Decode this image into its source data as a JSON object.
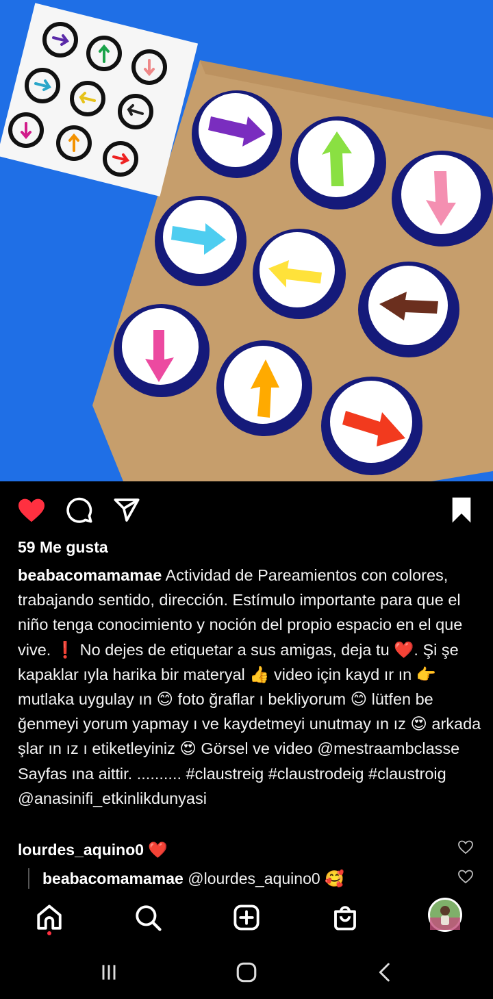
{
  "post": {
    "likes": "59 Me gusta",
    "author": "beabacomamamae",
    "caption": " Actividad de Pareamientos con colores, trabajando sentido, dirección. Estímulo importante para que el niño tenga conocimiento y noción del propio espacio en el que vive. ❗ No dejes de etiquetar a sus amigas, deja tu ❤️. Şi şe kapaklar ıyla harika bir materyal 👍 video için kayd ır ın 👉 mutlaka uygulay ın 😊 foto ğraflar ı bekliyorum 😊 lütfen be ğenmeyi yorum yapmay ı ve kaydetmeyi unutmay ın ız 😍 arkada şlar ın ız ı etiketleyiniz 😍 Görsel ve video @mestraambclasse Sayfas ına aittir. .......... #claustreig #claustrodeig #claustroig @anasinifi_etkinlikdunyasi"
  },
  "comments": [
    {
      "user": "lourdes_aquino0",
      "text": " ❤️"
    },
    {
      "user": "beabacomamamae",
      "text": " @lourdes_aquino0 🥰"
    }
  ],
  "icons": {
    "like": "heart-filled-icon",
    "comment": "comment-bubble-icon",
    "share": "paper-plane-icon",
    "save": "bookmark-filled-icon",
    "nav": [
      "home-icon",
      "search-icon",
      "add-post-icon",
      "shop-bag-icon",
      "profile-avatar"
    ],
    "system": [
      "recent-apps-icon",
      "home-pill-icon",
      "back-icon"
    ]
  },
  "colors": {
    "like": "#ff3040",
    "background": "#000000",
    "photo_background": "#1f6fe6"
  }
}
